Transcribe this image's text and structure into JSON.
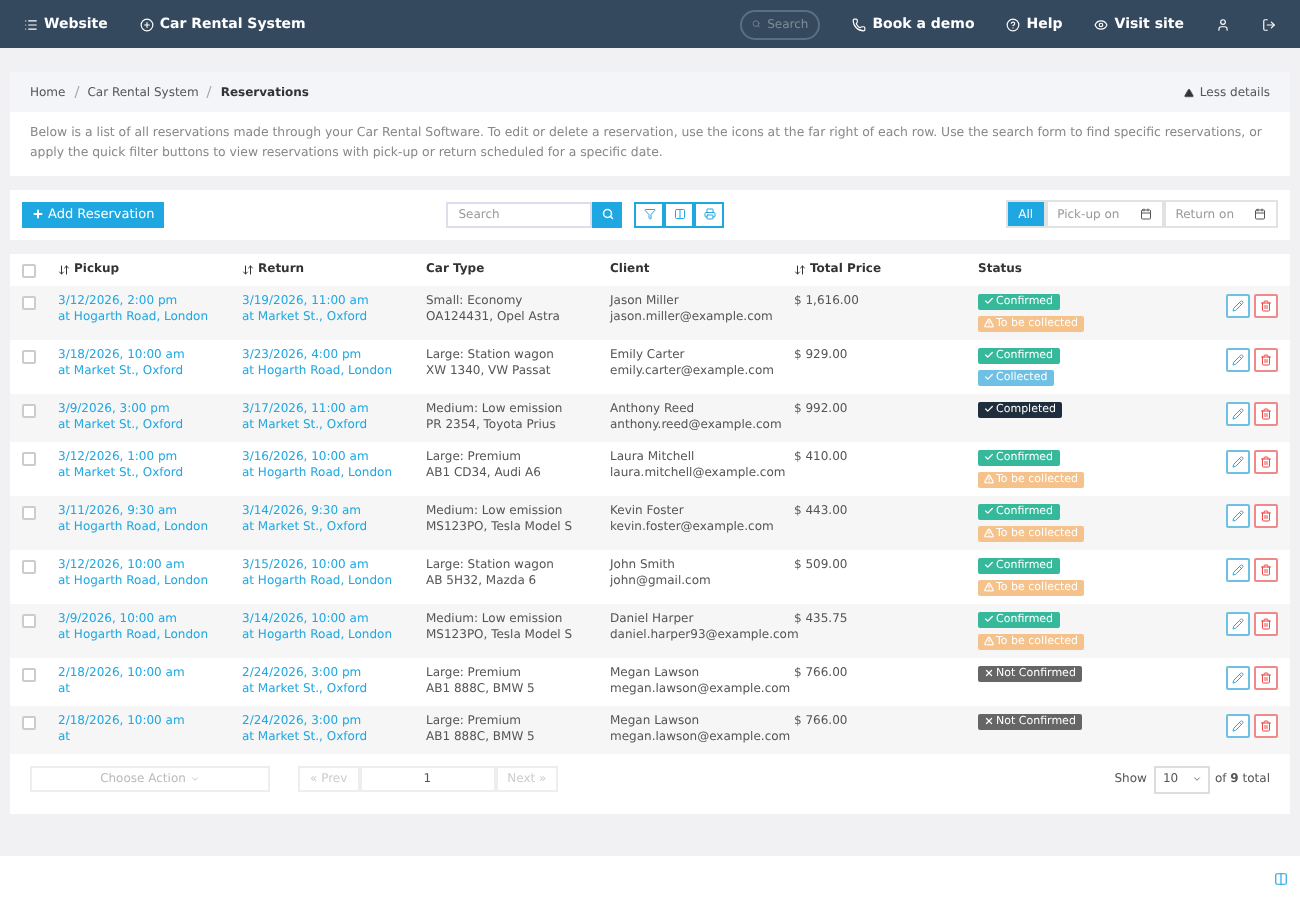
{
  "topbar": {
    "left": [
      {
        "kind": "list",
        "label": "Website"
      },
      {
        "kind": "plus",
        "label": "Car Rental System"
      }
    ],
    "search": {
      "placeholder": "Search"
    },
    "right": [
      {
        "kind": "phone",
        "label": "Book a demo"
      },
      {
        "kind": "help",
        "label": "Help"
      },
      {
        "kind": "eye",
        "label": "Visit site"
      },
      {
        "kind": "user"
      },
      {
        "kind": "logout"
      }
    ]
  },
  "breadcrumb": [
    "Home",
    "Car Rental System",
    "Reservations"
  ],
  "details_toggle": "Less details",
  "description": "Below is a list of all reservations made through your Car Rental Software. To edit or delete a reservation, use the icons at the far right of each row. Use the search form to find specific reservations, or apply the quick filter buttons to view reservations with pick-up or return scheduled for a specific date.",
  "add_button": "Add Reservation",
  "search": {
    "placeholder": "Search"
  },
  "filters": [
    {
      "label": "All",
      "selected": true
    },
    {
      "label": "Pick-up on",
      "selected": false
    },
    {
      "label": "Return on",
      "selected": false
    }
  ],
  "select_all": {
    "checked": false
  },
  "columns": [
    {
      "label": "Pickup",
      "sortable": true
    },
    {
      "label": "Return",
      "sortable": true
    },
    {
      "label": "Car Type",
      "sortable": false
    },
    {
      "label": "Client",
      "sortable": false
    },
    {
      "label": "Total Price",
      "sortable": true
    },
    {
      "label": "Status",
      "sortable": false
    }
  ],
  "rows": [
    {
      "checked": false,
      "pickup": [
        "3/12/2026, 2:00 pm",
        "at Hogarth Road, London"
      ],
      "return": [
        "3/19/2026, 11:00 am",
        "at Market St., Oxford"
      ],
      "car": [
        "Small: Economy",
        "OA124431, Opel Astra"
      ],
      "client": [
        "Jason Miller",
        "jason.miller@example.com"
      ],
      "price": "$ 1,616.00",
      "status": [
        {
          "kind": "confirmed",
          "label": "Confirmed"
        },
        {
          "kind": "pending",
          "label": "To be collected"
        }
      ]
    },
    {
      "checked": false,
      "pickup": [
        "3/18/2026, 10:00 am",
        "at Market St., Oxford"
      ],
      "return": [
        "3/23/2026, 4:00 pm",
        "at Hogarth Road, London"
      ],
      "car": [
        "Large: Station wagon",
        "XW 1340, VW Passat"
      ],
      "client": [
        "Emily Carter",
        "emily.carter@example.com"
      ],
      "price": "$ 929.00",
      "status": [
        {
          "kind": "confirmed",
          "label": "Confirmed"
        },
        {
          "kind": "collected",
          "label": "Collected"
        }
      ]
    },
    {
      "checked": false,
      "pickup": [
        "3/9/2026, 3:00 pm",
        "at Market St., Oxford"
      ],
      "return": [
        "3/17/2026, 11:00 am",
        "at Market St., Oxford"
      ],
      "car": [
        "Medium: Low emission",
        "PR 2354, Toyota Prius"
      ],
      "client": [
        "Anthony Reed",
        "anthony.reed@example.com"
      ],
      "price": "$ 992.00",
      "status": [
        {
          "kind": "completed",
          "label": "Completed"
        }
      ]
    },
    {
      "checked": false,
      "pickup": [
        "3/12/2026, 1:00 pm",
        "at Market St., Oxford"
      ],
      "return": [
        "3/16/2026, 10:00 am",
        "at Hogarth Road, London"
      ],
      "car": [
        "Large: Premium",
        "AB1 CD34, Audi A6"
      ],
      "client": [
        "Laura Mitchell",
        "laura.mitchell@example.com"
      ],
      "price": "$ 410.00",
      "status": [
        {
          "kind": "confirmed",
          "label": "Confirmed"
        },
        {
          "kind": "pending",
          "label": "To be collected"
        }
      ]
    },
    {
      "checked": false,
      "pickup": [
        "3/11/2026, 9:30 am",
        "at Hogarth Road, London"
      ],
      "return": [
        "3/14/2026, 9:30 am",
        "at Market St., Oxford"
      ],
      "car": [
        "Medium: Low emission",
        "MS123PO, Tesla Model S"
      ],
      "client": [
        "Kevin Foster",
        "kevin.foster@example.com"
      ],
      "price": "$ 443.00",
      "status": [
        {
          "kind": "confirmed",
          "label": "Confirmed"
        },
        {
          "kind": "pending",
          "label": "To be collected"
        }
      ]
    },
    {
      "checked": false,
      "pickup": [
        "3/12/2026, 10:00 am",
        "at Hogarth Road, London"
      ],
      "return": [
        "3/15/2026, 10:00 am",
        "at Hogarth Road, London"
      ],
      "car": [
        "Large: Station wagon",
        "AB 5H32, Mazda 6"
      ],
      "client": [
        "John Smith",
        "john@gmail.com"
      ],
      "price": "$ 509.00",
      "status": [
        {
          "kind": "confirmed",
          "label": "Confirmed"
        },
        {
          "kind": "pending",
          "label": "To be collected"
        }
      ]
    },
    {
      "checked": false,
      "pickup": [
        "3/9/2026, 10:00 am",
        "at Hogarth Road, London"
      ],
      "return": [
        "3/14/2026, 10:00 am",
        "at Hogarth Road, London"
      ],
      "car": [
        "Medium: Low emission",
        "MS123PO, Tesla Model S"
      ],
      "client": [
        "Daniel Harper",
        "daniel.harper93@example.com"
      ],
      "price": "$ 435.75",
      "status": [
        {
          "kind": "confirmed",
          "label": "Confirmed"
        },
        {
          "kind": "pending",
          "label": "To be collected"
        }
      ]
    },
    {
      "checked": false,
      "pickup": [
        "2/18/2026, 10:00 am",
        "at"
      ],
      "return": [
        "2/24/2026, 3:00 pm",
        "at Market St., Oxford"
      ],
      "car": [
        "Large: Premium",
        "AB1 888C, BMW 5"
      ],
      "client": [
        "Megan Lawson",
        "megan.lawson@example.com"
      ],
      "price": "$ 766.00",
      "status": [
        {
          "kind": "unconfirmed",
          "label": "Not Confirmed"
        }
      ]
    },
    {
      "checked": false,
      "pickup": [
        "2/18/2026, 10:00 am",
        "at"
      ],
      "return": [
        "2/24/2026, 3:00 pm",
        "at Market St., Oxford"
      ],
      "car": [
        "Large: Premium",
        "AB1 888C, BMW 5"
      ],
      "client": [
        "Megan Lawson",
        "megan.lawson@example.com"
      ],
      "price": "$ 766.00",
      "status": [
        {
          "kind": "unconfirmed",
          "label": "Not Confirmed"
        }
      ]
    }
  ],
  "footer": {
    "action": "Choose Action",
    "prev": "« Prev",
    "page": "1",
    "next": "Next »",
    "show_label": "Show",
    "page_size": "10",
    "total_prefix": "of",
    "total": "9",
    "total_suffix": "total"
  }
}
